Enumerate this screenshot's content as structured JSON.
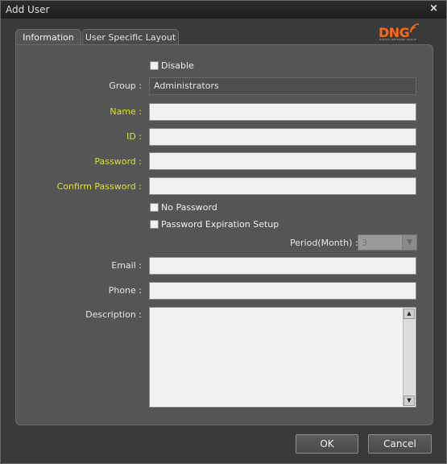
{
  "window": {
    "title": "Add User",
    "close_glyph": "×"
  },
  "tabs": [
    {
      "label": "Information",
      "active": true
    },
    {
      "label": "User Specific Layout",
      "active": false
    }
  ],
  "logo": {
    "text": "DNG",
    "subtext": "DIGITAL NETWORK GROUP"
  },
  "form": {
    "disable_label": "Disable",
    "group_label": "Group :",
    "group_value": "Administrators",
    "name_label": "Name :",
    "id_label": "ID :",
    "password_label": "Password :",
    "confirm_password_label": "Confirm Password :",
    "no_password_label": "No Password",
    "password_expiration_label": "Password Expiration Setup",
    "period_label": "Period(Month) :",
    "period_value": "3",
    "email_label": "Email :",
    "phone_label": "Phone :",
    "description_label": "Description :"
  },
  "buttons": {
    "ok": "OK",
    "cancel": "Cancel"
  },
  "colors": {
    "required_label": "#d8e23a",
    "logo": "#ff6a1a",
    "background": "#3a3a3a"
  }
}
